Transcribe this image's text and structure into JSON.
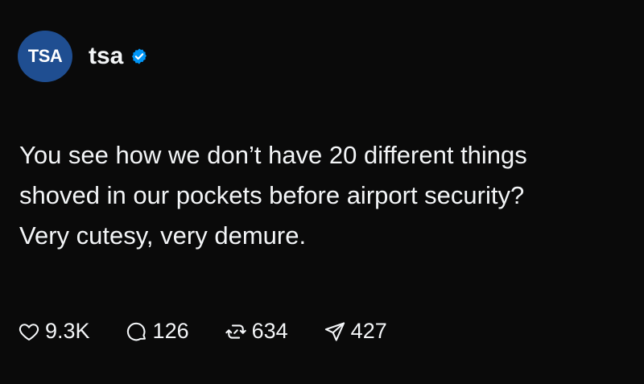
{
  "profile": {
    "avatar_text": "TSA",
    "username": "tsa",
    "verified_icon": "verified-badge-icon",
    "verified_color": "#0095f6",
    "avatar_color": "#1f4e91"
  },
  "post": {
    "text": "You see how we don’t have 20 different things\nshoved in our pockets before airport security?\nVery cutesy, very demure."
  },
  "actions": {
    "likes": "9.3K",
    "comments": "126",
    "reposts": "634",
    "shares": "427"
  },
  "icons": {
    "like": "heart-icon",
    "comment": "comment-bubble-icon",
    "repost": "repost-icon",
    "share": "send-icon"
  }
}
